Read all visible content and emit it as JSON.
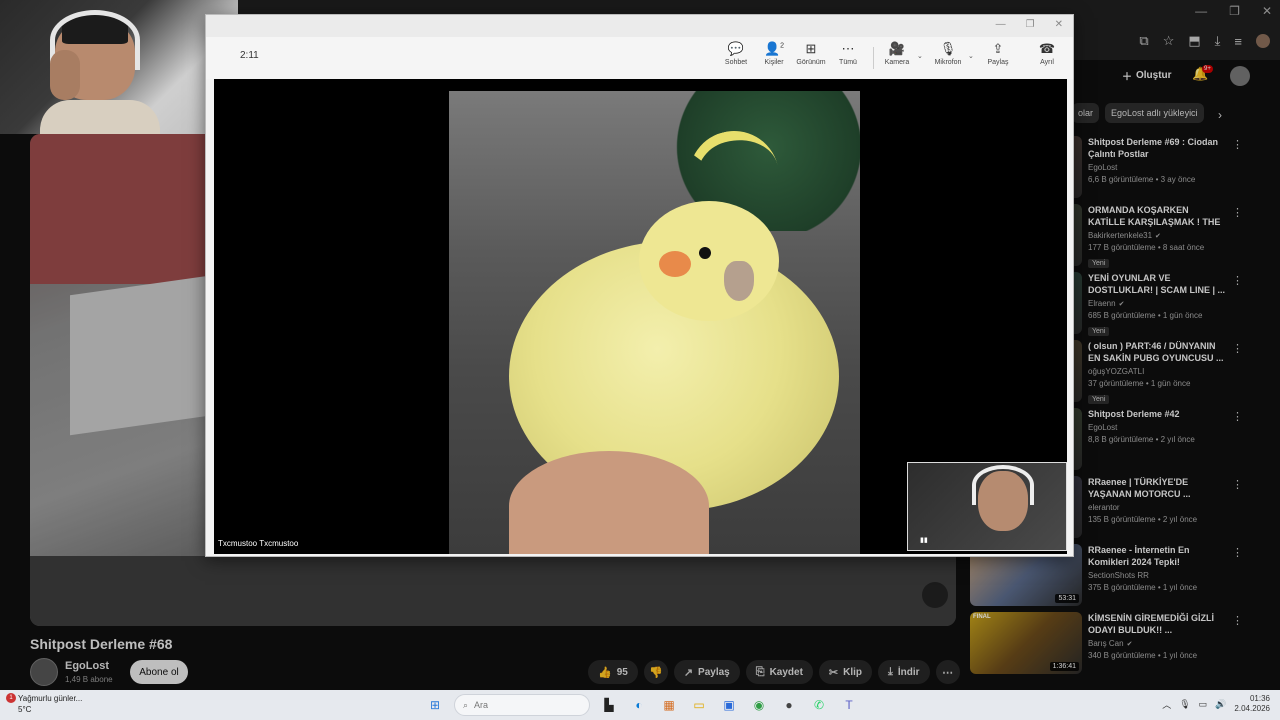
{
  "browser": {
    "window_controls": [
      "—",
      "❐",
      "✕"
    ],
    "toolbar_icons": [
      "⧉",
      "☆",
      "⬒",
      "⤓",
      "≡"
    ]
  },
  "youtube": {
    "title": "Shitpost Derleme #68",
    "channel": {
      "name": "EgoLost",
      "subs": "1,49 B abone",
      "subscribe": "Abone ol"
    },
    "actions": {
      "likes": "95",
      "share": "Paylaş",
      "save": "Kaydet",
      "clip": "Klip",
      "download": "İndir"
    },
    "header": {
      "create": "Oluştur",
      "notif_badge": "9+"
    },
    "chips": [
      "olar",
      "EgoLost adlı yükleyici"
    ],
    "recommendations": [
      {
        "title": "Shitpost Derleme #69 : Ciodan Çalıntı Postlar",
        "channel": "EgoLost",
        "verified": false,
        "meta": "6,6 B görüntüleme • 3 ay önce",
        "badge": "",
        "duration": "",
        "thumb_label": ""
      },
      {
        "title": "ORMANDA KOŞARKEN KATİLLE KARŞILAŞMAK ! THE RUN",
        "channel": "Bakirkertenkele31",
        "verified": true,
        "meta": "177 B görüntüleme • 8 saat önce",
        "badge": "Yeni",
        "duration": "",
        "thumb_label": ""
      },
      {
        "title": "YENİ OYUNLAR VE DOSTLUKLAR! | SCAM LINE | ...",
        "channel": "Elraenn",
        "verified": true,
        "meta": "685 B görüntüleme • 1 gün önce",
        "badge": "Yeni",
        "duration": "",
        "thumb_label": ""
      },
      {
        "title": "( olsun ) PART:46 / DÜNYANIN EN SAKİN PUBG OYUNCUSU ...",
        "channel": "oğuşYOZGATLI",
        "verified": false,
        "meta": "37 görüntüleme • 1 gün önce",
        "badge": "Yeni",
        "duration": "",
        "thumb_label": ""
      },
      {
        "title": "Shitpost Derleme #42",
        "channel": "EgoLost",
        "verified": false,
        "meta": "8,8 B görüntüleme • 2 yıl önce",
        "badge": "",
        "duration": "",
        "thumb_label": ""
      },
      {
        "title": "RRaenee | TÜRKİYE'DE YAŞANAN MOTORCU ...",
        "channel": "elerantor",
        "verified": false,
        "meta": "135 B görüntüleme • 2 yıl önce",
        "badge": "",
        "duration": "",
        "thumb_label": ""
      },
      {
        "title": "RRaenee - İnternetin En Komikleri 2024 Tepki!",
        "channel": "SectionShots RR",
        "verified": false,
        "meta": "375 B görüntüleme • 1 yıl önce",
        "badge": "",
        "duration": "53:31",
        "thumb_label": "İNTERNETİN EN İYİLERİ 2024"
      },
      {
        "title": "KİMSENİN GİREMEDİĞİ GİZLİ ODAYI BULDUK!! ...",
        "channel": "Barış Can",
        "verified": true,
        "meta": "340 B görüntüleme • 1 yıl önce",
        "badge": "",
        "duration": "1:36:41",
        "thumb_label": "FINAL"
      }
    ]
  },
  "teams": {
    "timer": "2:11",
    "buttons": {
      "chat": "Sohbet",
      "people": "Kişiler",
      "people_count": "2",
      "view": "Görünüm",
      "more": "Tümü",
      "camera": "Kamera",
      "mic": "Mikrofon",
      "share": "Paylaş",
      "leave": "Ayrıl"
    },
    "participant_name": "Txcmustoo Txcmustoo"
  },
  "taskbar": {
    "weather_text": "Yağmurlu günler...",
    "weather_temp": "5°C",
    "weather_badge": "1",
    "search_placeholder": "Ara",
    "time": "01:36",
    "date": "2.04.2026"
  }
}
